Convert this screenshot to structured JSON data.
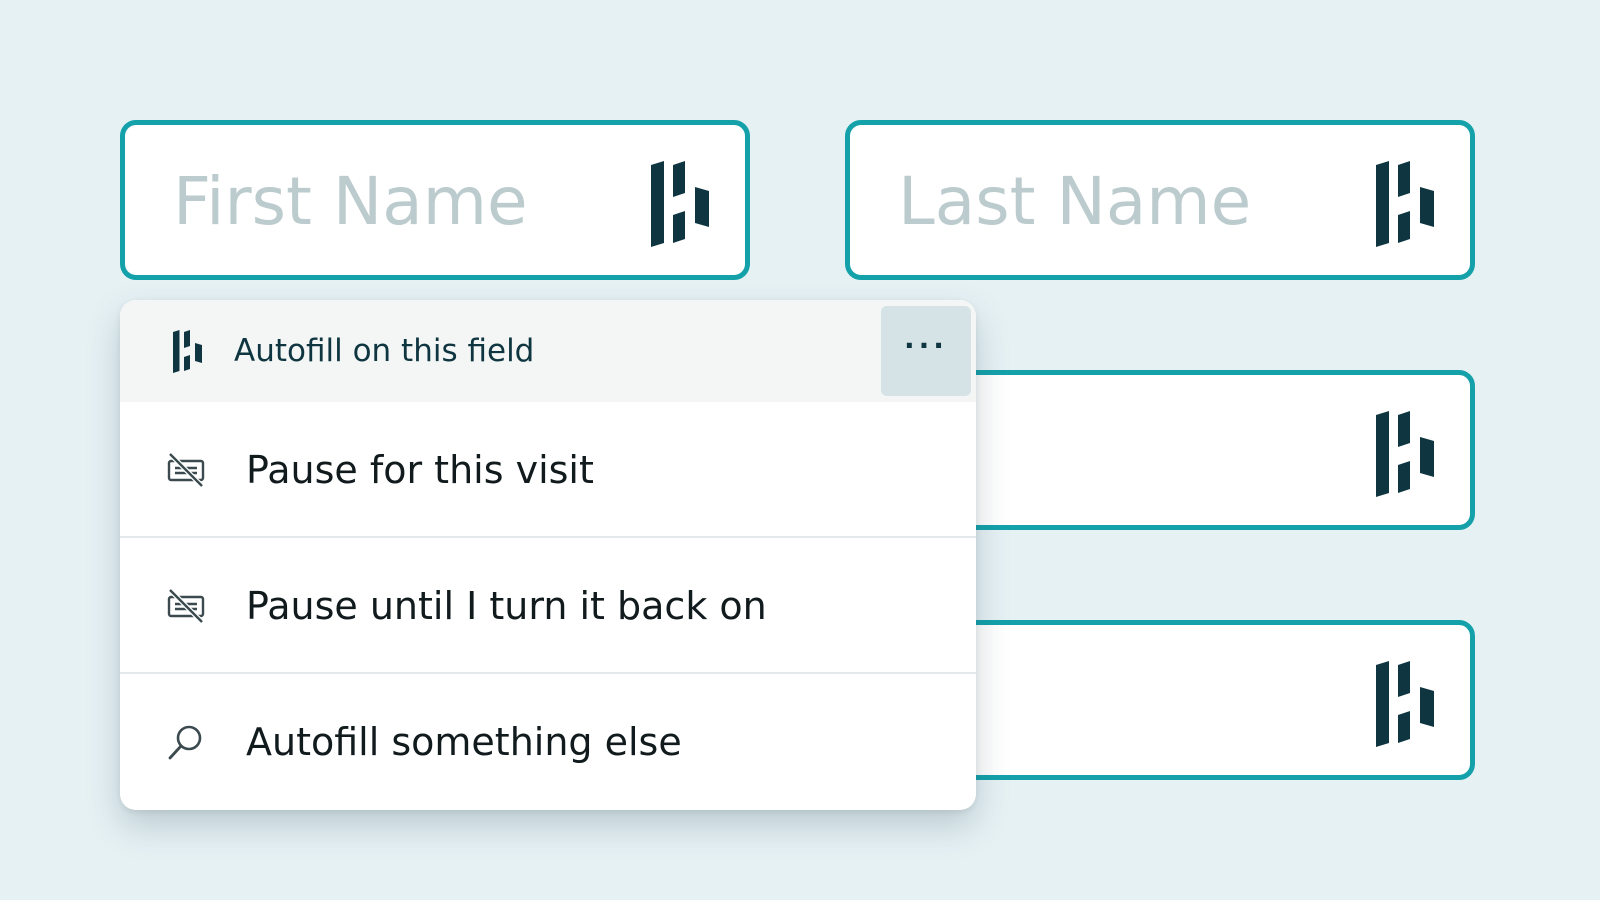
{
  "colors": {
    "background": "#e6f1f4",
    "field_border": "#14a1aa",
    "placeholder": "#bccbcd",
    "brand_dark": "#0f3640",
    "dropdown_header_bg": "#f3f6f5",
    "more_button_bg": "#d5e2e6"
  },
  "fields": {
    "first_name": {
      "placeholder": "First Name",
      "icon": "dashlane-logo-icon"
    },
    "last_name": {
      "placeholder": "Last Name",
      "icon": "dashlane-logo-icon"
    },
    "field_3": {
      "placeholder": "",
      "icon": "dashlane-logo-icon"
    },
    "field_4": {
      "placeholder": "",
      "icon": "dashlane-logo-icon"
    }
  },
  "dropdown": {
    "header": {
      "icon": "dashlane-logo-icon",
      "title": "Autofill on this field",
      "more_button": {
        "label": "···",
        "icon": "more-horizontal-icon"
      }
    },
    "items": [
      {
        "label": "Pause for this visit",
        "icon": "autofill-off-icon"
      },
      {
        "label": "Pause until I turn it back on",
        "icon": "autofill-off-icon"
      },
      {
        "label": "Autofill something else",
        "icon": "search-icon"
      }
    ]
  }
}
